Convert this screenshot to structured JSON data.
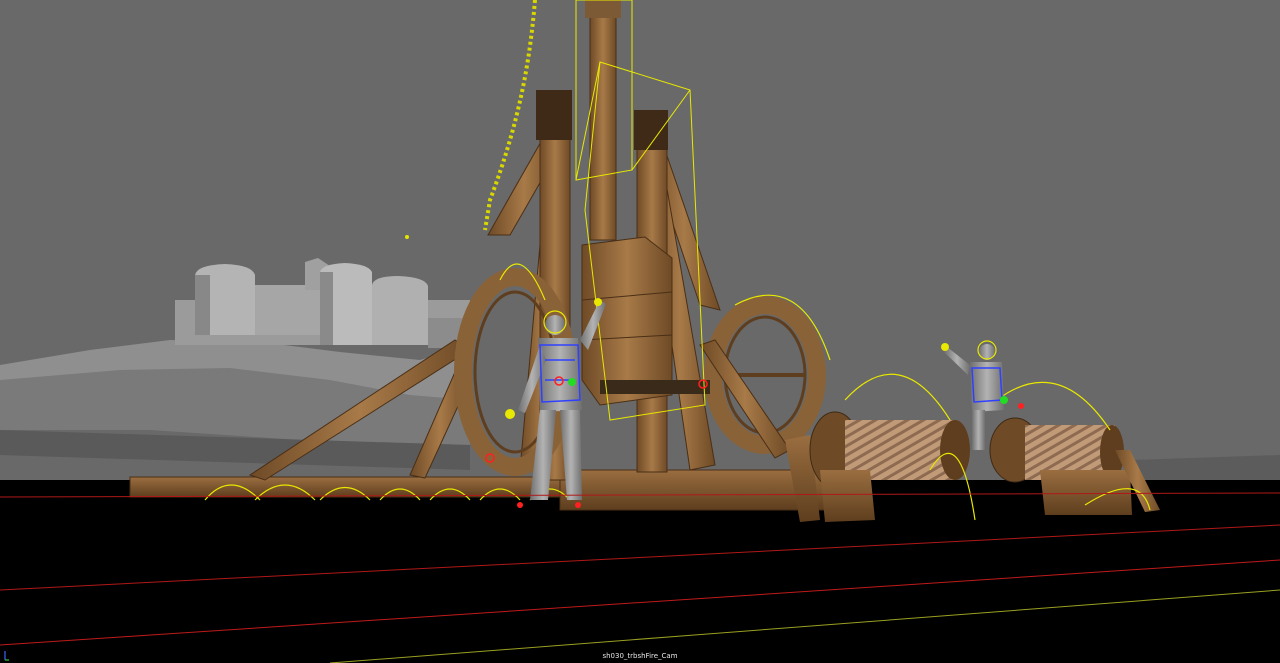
{
  "viewport": {
    "camera_label": "sh030_trbshFire_Cam",
    "background_color": "#696969",
    "ground_color": "#000000"
  },
  "scene": {
    "objects": [
      "castle-model",
      "terrain-model",
      "trebuchet-model",
      "counterweight-box",
      "treadwheel-left",
      "treadwheel-right",
      "winch-drum-left",
      "winch-drum-right",
      "character-rig-front",
      "character-rig-right",
      "hanging-chain"
    ],
    "selection_color": "#ffff00",
    "rig_colors": {
      "spine": "#2f3cff",
      "controls_red": "#ff2020",
      "controls_green": "#22dd22",
      "controls_yellow": "#f4f400"
    },
    "wood_color": "#8a6238"
  },
  "icons": [
    "axis-indicator-icon"
  ]
}
